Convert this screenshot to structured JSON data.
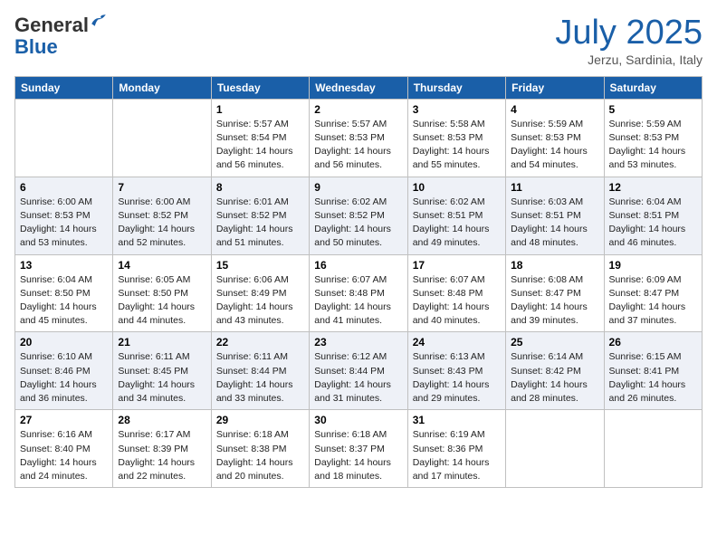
{
  "header": {
    "logo_general": "General",
    "logo_blue": "Blue",
    "month": "July 2025",
    "location": "Jerzu, Sardinia, Italy"
  },
  "days_of_week": [
    "Sunday",
    "Monday",
    "Tuesday",
    "Wednesday",
    "Thursday",
    "Friday",
    "Saturday"
  ],
  "weeks": [
    [
      {
        "day": "",
        "sunrise": "",
        "sunset": "",
        "daylight": ""
      },
      {
        "day": "",
        "sunrise": "",
        "sunset": "",
        "daylight": ""
      },
      {
        "day": "1",
        "sunrise": "Sunrise: 5:57 AM",
        "sunset": "Sunset: 8:54 PM",
        "daylight": "Daylight: 14 hours and 56 minutes."
      },
      {
        "day": "2",
        "sunrise": "Sunrise: 5:57 AM",
        "sunset": "Sunset: 8:53 PM",
        "daylight": "Daylight: 14 hours and 56 minutes."
      },
      {
        "day": "3",
        "sunrise": "Sunrise: 5:58 AM",
        "sunset": "Sunset: 8:53 PM",
        "daylight": "Daylight: 14 hours and 55 minutes."
      },
      {
        "day": "4",
        "sunrise": "Sunrise: 5:59 AM",
        "sunset": "Sunset: 8:53 PM",
        "daylight": "Daylight: 14 hours and 54 minutes."
      },
      {
        "day": "5",
        "sunrise": "Sunrise: 5:59 AM",
        "sunset": "Sunset: 8:53 PM",
        "daylight": "Daylight: 14 hours and 53 minutes."
      }
    ],
    [
      {
        "day": "6",
        "sunrise": "Sunrise: 6:00 AM",
        "sunset": "Sunset: 8:53 PM",
        "daylight": "Daylight: 14 hours and 53 minutes."
      },
      {
        "day": "7",
        "sunrise": "Sunrise: 6:00 AM",
        "sunset": "Sunset: 8:52 PM",
        "daylight": "Daylight: 14 hours and 52 minutes."
      },
      {
        "day": "8",
        "sunrise": "Sunrise: 6:01 AM",
        "sunset": "Sunset: 8:52 PM",
        "daylight": "Daylight: 14 hours and 51 minutes."
      },
      {
        "day": "9",
        "sunrise": "Sunrise: 6:02 AM",
        "sunset": "Sunset: 8:52 PM",
        "daylight": "Daylight: 14 hours and 50 minutes."
      },
      {
        "day": "10",
        "sunrise": "Sunrise: 6:02 AM",
        "sunset": "Sunset: 8:51 PM",
        "daylight": "Daylight: 14 hours and 49 minutes."
      },
      {
        "day": "11",
        "sunrise": "Sunrise: 6:03 AM",
        "sunset": "Sunset: 8:51 PM",
        "daylight": "Daylight: 14 hours and 48 minutes."
      },
      {
        "day": "12",
        "sunrise": "Sunrise: 6:04 AM",
        "sunset": "Sunset: 8:51 PM",
        "daylight": "Daylight: 14 hours and 46 minutes."
      }
    ],
    [
      {
        "day": "13",
        "sunrise": "Sunrise: 6:04 AM",
        "sunset": "Sunset: 8:50 PM",
        "daylight": "Daylight: 14 hours and 45 minutes."
      },
      {
        "day": "14",
        "sunrise": "Sunrise: 6:05 AM",
        "sunset": "Sunset: 8:50 PM",
        "daylight": "Daylight: 14 hours and 44 minutes."
      },
      {
        "day": "15",
        "sunrise": "Sunrise: 6:06 AM",
        "sunset": "Sunset: 8:49 PM",
        "daylight": "Daylight: 14 hours and 43 minutes."
      },
      {
        "day": "16",
        "sunrise": "Sunrise: 6:07 AM",
        "sunset": "Sunset: 8:48 PM",
        "daylight": "Daylight: 14 hours and 41 minutes."
      },
      {
        "day": "17",
        "sunrise": "Sunrise: 6:07 AM",
        "sunset": "Sunset: 8:48 PM",
        "daylight": "Daylight: 14 hours and 40 minutes."
      },
      {
        "day": "18",
        "sunrise": "Sunrise: 6:08 AM",
        "sunset": "Sunset: 8:47 PM",
        "daylight": "Daylight: 14 hours and 39 minutes."
      },
      {
        "day": "19",
        "sunrise": "Sunrise: 6:09 AM",
        "sunset": "Sunset: 8:47 PM",
        "daylight": "Daylight: 14 hours and 37 minutes."
      }
    ],
    [
      {
        "day": "20",
        "sunrise": "Sunrise: 6:10 AM",
        "sunset": "Sunset: 8:46 PM",
        "daylight": "Daylight: 14 hours and 36 minutes."
      },
      {
        "day": "21",
        "sunrise": "Sunrise: 6:11 AM",
        "sunset": "Sunset: 8:45 PM",
        "daylight": "Daylight: 14 hours and 34 minutes."
      },
      {
        "day": "22",
        "sunrise": "Sunrise: 6:11 AM",
        "sunset": "Sunset: 8:44 PM",
        "daylight": "Daylight: 14 hours and 33 minutes."
      },
      {
        "day": "23",
        "sunrise": "Sunrise: 6:12 AM",
        "sunset": "Sunset: 8:44 PM",
        "daylight": "Daylight: 14 hours and 31 minutes."
      },
      {
        "day": "24",
        "sunrise": "Sunrise: 6:13 AM",
        "sunset": "Sunset: 8:43 PM",
        "daylight": "Daylight: 14 hours and 29 minutes."
      },
      {
        "day": "25",
        "sunrise": "Sunrise: 6:14 AM",
        "sunset": "Sunset: 8:42 PM",
        "daylight": "Daylight: 14 hours and 28 minutes."
      },
      {
        "day": "26",
        "sunrise": "Sunrise: 6:15 AM",
        "sunset": "Sunset: 8:41 PM",
        "daylight": "Daylight: 14 hours and 26 minutes."
      }
    ],
    [
      {
        "day": "27",
        "sunrise": "Sunrise: 6:16 AM",
        "sunset": "Sunset: 8:40 PM",
        "daylight": "Daylight: 14 hours and 24 minutes."
      },
      {
        "day": "28",
        "sunrise": "Sunrise: 6:17 AM",
        "sunset": "Sunset: 8:39 PM",
        "daylight": "Daylight: 14 hours and 22 minutes."
      },
      {
        "day": "29",
        "sunrise": "Sunrise: 6:18 AM",
        "sunset": "Sunset: 8:38 PM",
        "daylight": "Daylight: 14 hours and 20 minutes."
      },
      {
        "day": "30",
        "sunrise": "Sunrise: 6:18 AM",
        "sunset": "Sunset: 8:37 PM",
        "daylight": "Daylight: 14 hours and 18 minutes."
      },
      {
        "day": "31",
        "sunrise": "Sunrise: 6:19 AM",
        "sunset": "Sunset: 8:36 PM",
        "daylight": "Daylight: 14 hours and 17 minutes."
      },
      {
        "day": "",
        "sunrise": "",
        "sunset": "",
        "daylight": ""
      },
      {
        "day": "",
        "sunrise": "",
        "sunset": "",
        "daylight": ""
      }
    ]
  ]
}
